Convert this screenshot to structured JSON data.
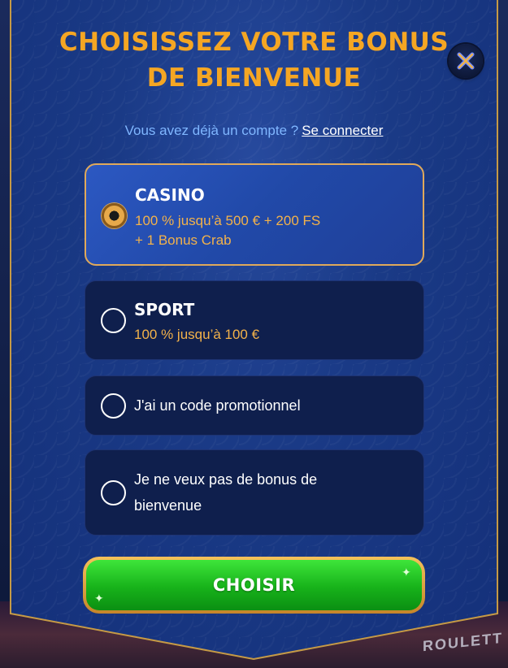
{
  "header": {
    "title": "CHOISISSEZ VOTRE BONUS DE BIENVENUE",
    "close_icon": "close-x-icon"
  },
  "account": {
    "question": "Vous avez déjà un compte ?",
    "login_link": "Se connecter"
  },
  "options": [
    {
      "title": "CASINO",
      "desc_line1": "100 % jusqu’à 500 € + 200 FS",
      "desc_line2": "+ 1 Bonus Crab",
      "selected": true
    },
    {
      "title": "SPORT",
      "desc_line1": "100 % jusqu’à 100 €",
      "selected": false
    },
    {
      "label": "J'ai un code promotionnel",
      "selected": false
    },
    {
      "label_line1": "Je ne veux pas de bonus de",
      "label_line2": "bienvenue",
      "selected": false
    }
  ],
  "actions": {
    "choose_label": "CHOISIR"
  },
  "background": {
    "game_label": "ROULETT"
  },
  "colors": {
    "title": "#f5a623",
    "accent_gold": "#e0a95a",
    "button_green": "#17b21a",
    "link_blue": "#7fb6ff"
  }
}
